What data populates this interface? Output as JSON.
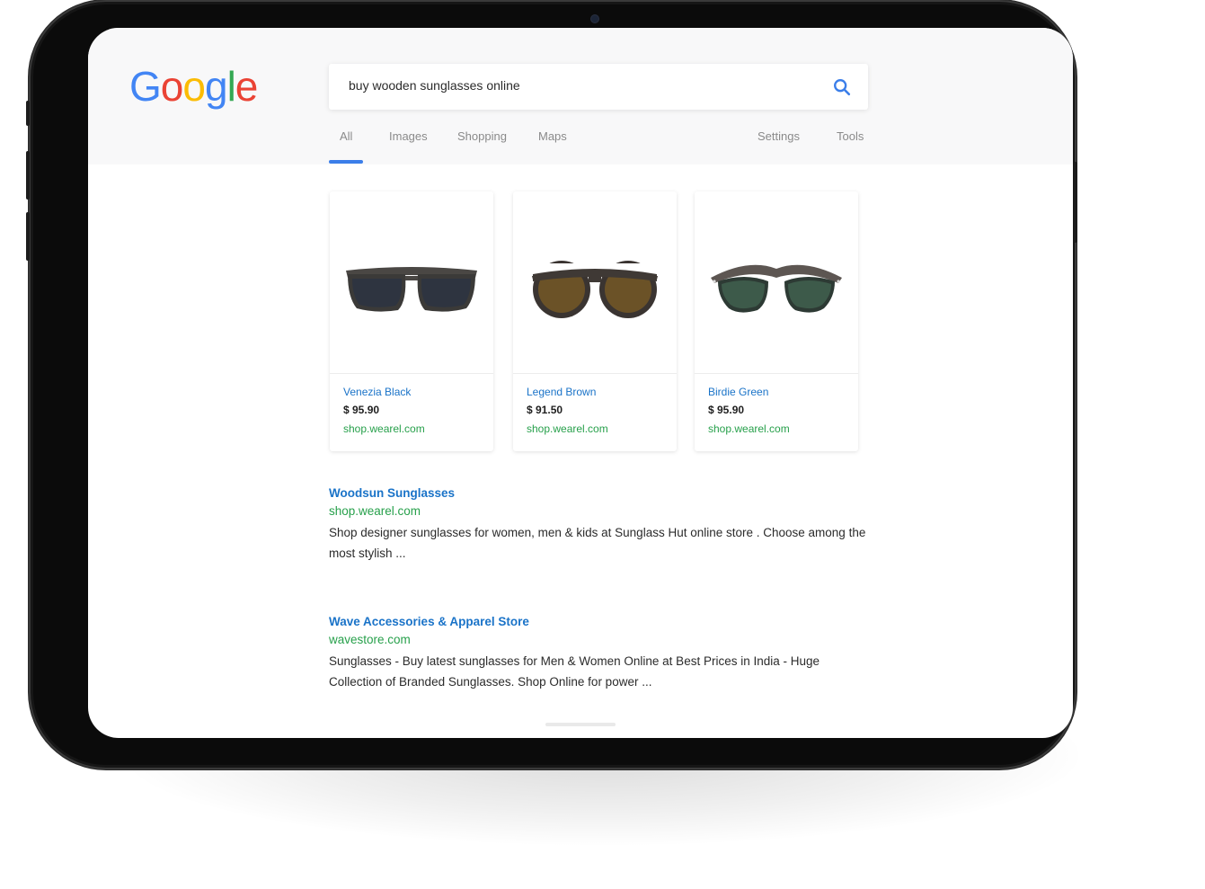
{
  "logo": {
    "letters": [
      "G",
      "o",
      "o",
      "g",
      "l",
      "e"
    ]
  },
  "search": {
    "query": "buy wooden sunglasses online"
  },
  "tabs": {
    "left": [
      "All",
      "Images",
      "Shopping",
      "Maps"
    ],
    "right": [
      "Settings",
      "Tools"
    ],
    "active": "All"
  },
  "products": [
    {
      "name": "Venezia Black",
      "price": "$ 95.90",
      "domain": "shop.wearel.com",
      "lens_color": "#2e3440"
    },
    {
      "name": "Legend Brown",
      "price": "$ 91.50",
      "domain": "shop.wearel.com",
      "lens_color": "#5a4321"
    },
    {
      "name": "Birdie Green",
      "price": "$ 95.90",
      "domain": "shop.wearel.com",
      "lens_color": "#2f4a3e"
    }
  ],
  "results": [
    {
      "title": "Woodsun Sunglasses",
      "url": "shop.wearel.com",
      "desc": "Shop designer sunglasses for women, men & kids at Sunglass Hut online store . Choose among the most stylish ..."
    },
    {
      "title": "Wave Accessories & Apparel Store",
      "url": "wavestore.com",
      "desc": "Sunglasses - Buy latest sunglasses for Men & Women Online at Best Prices in India - Huge Collection of Branded Sunglasses. Shop Online for power ..."
    }
  ],
  "colors": {
    "link": "#1a73c8",
    "url": "#27a04b",
    "accent": "#3b7ee9",
    "google_blue": "#4285f4",
    "google_red": "#ea4335",
    "google_yellow": "#fbbc05",
    "google_green": "#34a853"
  },
  "icons": {
    "search": "search-icon"
  }
}
